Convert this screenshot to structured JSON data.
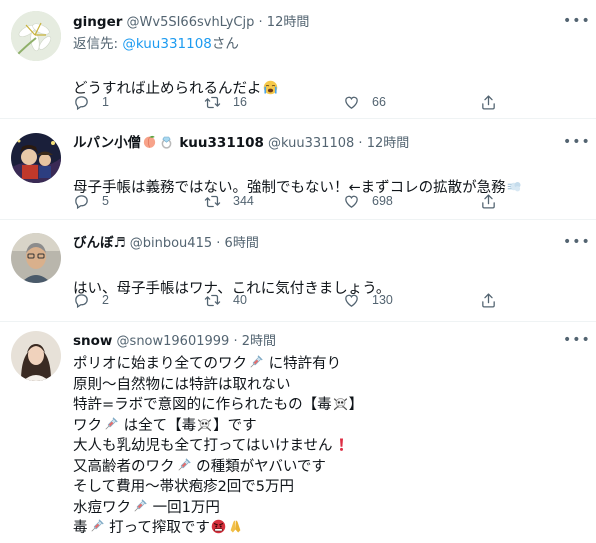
{
  "tweets": [
    {
      "name": "ginger",
      "handle": "@Wv5SI66svhLyCjp",
      "dot": "·",
      "time": "12時間",
      "reply_prefix": "返信先: ",
      "reply_user": "@kuu331108",
      "reply_suffix": "さん",
      "text": "どうすれば止められるんだよ",
      "text_emoji": "crying-face",
      "replies": "1",
      "retweets": "16",
      "likes": "66"
    },
    {
      "name": "ルパン小僧",
      "name_emojis": [
        "peach",
        "ring"
      ],
      "name_suffix": "kuu331108",
      "handle": "@kuu331108",
      "dot": "·",
      "time": "12時間",
      "text": "母子手帳は義務ではない。強制でもない！←まずコレの拡散が急務",
      "text_emoji": "dash",
      "replies": "5",
      "retweets": "344",
      "likes": "698"
    },
    {
      "name": "びんぼ♬",
      "handle": "@binbou415",
      "dot": "·",
      "time": "6時間",
      "text": "はい、母子手帳はワナ、これに気付きましょう。",
      "replies": "2",
      "retweets": "40",
      "likes": "130"
    },
    {
      "name": "snow",
      "handle": "@snow19601999",
      "dot": "·",
      "time": "2時間",
      "lines": [
        {
          "parts": [
            "ポリオに始まり全てのワク",
            "syringe",
            " に特許有り"
          ]
        },
        {
          "parts": [
            "原則〜自然物には特許は取れない"
          ]
        },
        {
          "parts": [
            "特許=ラボで意図的に作られたもの【毒",
            "skull",
            "】"
          ]
        },
        {
          "parts": [
            "ワク",
            "syringe",
            " は全て【毒",
            "skull",
            "】です"
          ]
        },
        {
          "parts": [
            "大人も乳幼児も全て打ってはいけません",
            "exclamation"
          ]
        },
        {
          "parts": [
            "又高齢者のワク",
            "syringe",
            " の種類がヤバいです"
          ]
        },
        {
          "parts": [
            "そして費用〜帯状疱疹2回で5万円"
          ]
        },
        {
          "parts": [
            "水痘ワク",
            "syringe",
            " 一回1万円"
          ]
        },
        {
          "parts": [
            "毒",
            "syringe",
            " 打って搾取です",
            "angry-face",
            "folded-hands"
          ]
        }
      ]
    }
  ],
  "icons": {
    "more": "more-icon",
    "reply": "reply-icon",
    "retweet": "retweet-icon",
    "like": "like-icon",
    "share": "share-icon"
  },
  "colors": {
    "text": "#0f1419",
    "secondary": "#536471",
    "link": "#1d9bf0",
    "divider": "#eff3f4"
  }
}
